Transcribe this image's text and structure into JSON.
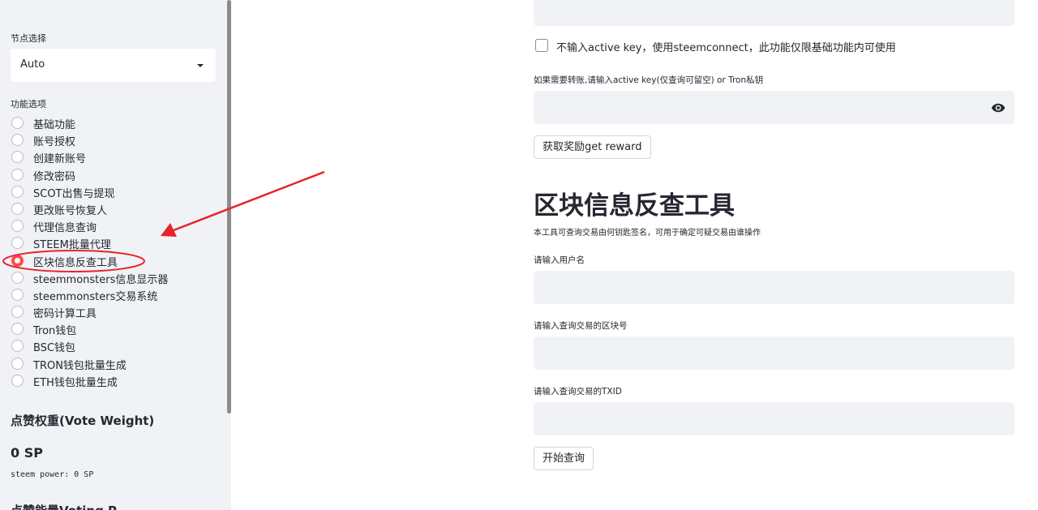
{
  "sidebar": {
    "node_label": "节点选择",
    "node_value": "Auto",
    "options_label": "功能选项",
    "options": [
      {
        "label": "基础功能",
        "selected": false
      },
      {
        "label": "账号授权",
        "selected": false
      },
      {
        "label": "创建新账号",
        "selected": false
      },
      {
        "label": "修改密码",
        "selected": false
      },
      {
        "label": "SCOT出售与提现",
        "selected": false
      },
      {
        "label": "更改账号恢复人",
        "selected": false
      },
      {
        "label": "代理信息查询",
        "selected": false
      },
      {
        "label": "STEEM批量代理",
        "selected": false
      },
      {
        "label": "区块信息反查工具",
        "selected": true
      },
      {
        "label": "steemmonsters信息显示器",
        "selected": false
      },
      {
        "label": "steemmonsters交易系统",
        "selected": false
      },
      {
        "label": "密码计算工具",
        "selected": false
      },
      {
        "label": "Tron钱包",
        "selected": false
      },
      {
        "label": "BSC钱包",
        "selected": false
      },
      {
        "label": "TRON钱包批量生成",
        "selected": false
      },
      {
        "label": "ETH钱包批量生成",
        "selected": false
      }
    ],
    "vote_weight_title": "点赞权重(Vote Weight)",
    "sp_value": "0 SP",
    "steem_power_text": "steem power: 0 SP",
    "cut_heading": "点赞能量Voting P"
  },
  "main": {
    "checkbox_label": "不输入active key，使用steemconnect，此功能仅限基础功能内可使用",
    "active_key_label": "如果需要转账,请输入active key(仅查询可留空) or Tron私钥",
    "reward_button": "获取奖励get reward",
    "title": "区块信息反查工具",
    "description": "本工具可查询交易由何钥匙签名，可用于确定可疑交易由谁操作",
    "username_label": "请输入用户名",
    "block_label": "请输入查询交易的区块号",
    "txid_label": "请输入查询交易的TXID",
    "query_button": "开始查询"
  },
  "colors": {
    "accent": "#ff4b4b",
    "annotation": "#e8232b",
    "sidebar_bg": "#f0f2f6",
    "input_bg": "#f0f2f6"
  }
}
